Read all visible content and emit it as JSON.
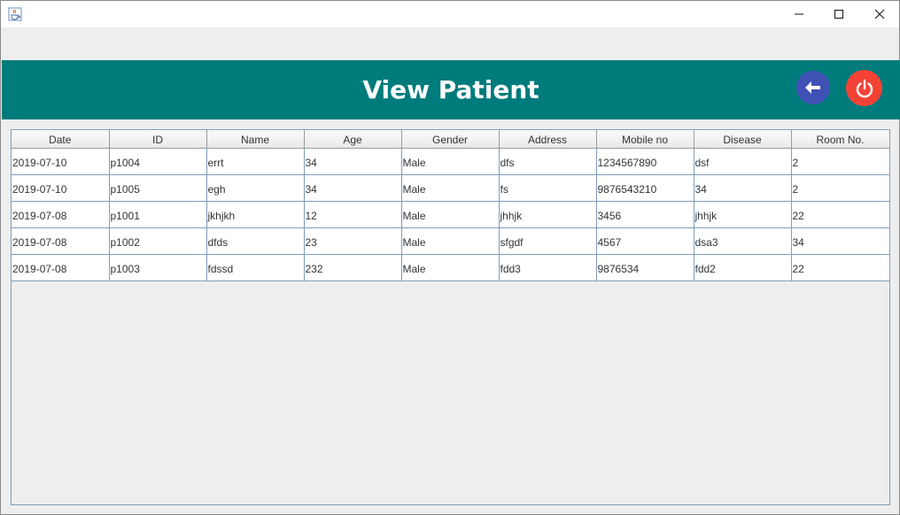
{
  "window": {
    "app_icon": "java-cup-icon",
    "controls": [
      "minimize-icon",
      "maximize-icon",
      "close-icon"
    ]
  },
  "header": {
    "title": "View Patient",
    "back_icon": "arrow-left-icon",
    "power_icon": "power-icon",
    "bg_color": "#007b7b",
    "back_color": "#3f51b5",
    "power_color": "#f44336"
  },
  "table": {
    "columns": [
      "Date",
      "ID",
      "Name",
      "Age",
      "Gender",
      "Address",
      "Mobile no",
      "Disease",
      "Room No."
    ],
    "rows": [
      [
        "2019-07-10",
        "p1004",
        "errt",
        "34",
        "Male",
        "dfs",
        "1234567890",
        "dsf",
        "2"
      ],
      [
        "2019-07-10",
        "p1005",
        "egh",
        "34",
        "Male",
        "fs",
        "9876543210",
        "34",
        "2"
      ],
      [
        "2019-07-08",
        "p1001",
        "jkhjkh",
        "12",
        "Male",
        "jhhjk",
        "3456",
        "jhhjk",
        "22"
      ],
      [
        "2019-07-08",
        "p1002",
        "dfds",
        "23",
        "Male",
        "sfgdf",
        "4567",
        "dsa3",
        "34"
      ],
      [
        "2019-07-08",
        "p1003",
        "fdssd",
        "232",
        "Male",
        "fdd3",
        "9876534",
        "fdd2",
        "22"
      ]
    ]
  }
}
